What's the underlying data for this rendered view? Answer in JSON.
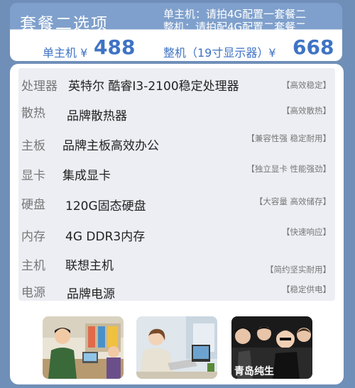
{
  "header": {
    "title": "套餐二选项",
    "note_host": "单主机：请拍4G配置一套餐二",
    "note_full": "整机：请拍配4G配置二套餐二",
    "host_label": "单主机 ¥",
    "host_price": "488",
    "full_label": "整机（19寸显示器）¥",
    "full_price": "668"
  },
  "specs": [
    {
      "label": "处理器",
      "value": "英特尔  酷睿I3-2100稳定处理器",
      "tag": "【高效稳定】"
    },
    {
      "label": "散热",
      "value": "品牌散热器",
      "tag": "【高效散热】"
    },
    {
      "label": "主板",
      "value": "品牌主板高效办公",
      "tag": "【兼容性强 稳定耐用】"
    },
    {
      "label": "显卡",
      "value": "集成显卡",
      "tag": "【独立显卡 性能强劲】"
    },
    {
      "label": "硬盘",
      "value": "120G固态硬盘",
      "tag": "【大容量 高效储存】"
    },
    {
      "label": "内存",
      "value": "4G DDR3内存",
      "tag": "【快速响应】"
    },
    {
      "label": "主机",
      "value": "联想主机",
      "tag": "【简约坚实耐用】"
    },
    {
      "label": "电源",
      "value": "品牌电源",
      "tag": "【稳定供电】"
    }
  ],
  "photos": {
    "p3_caption": "青岛纯生"
  },
  "colors": {
    "background": "#6f8fb8",
    "accent": "#3f73c4",
    "header_band": "#7fa0cc"
  }
}
